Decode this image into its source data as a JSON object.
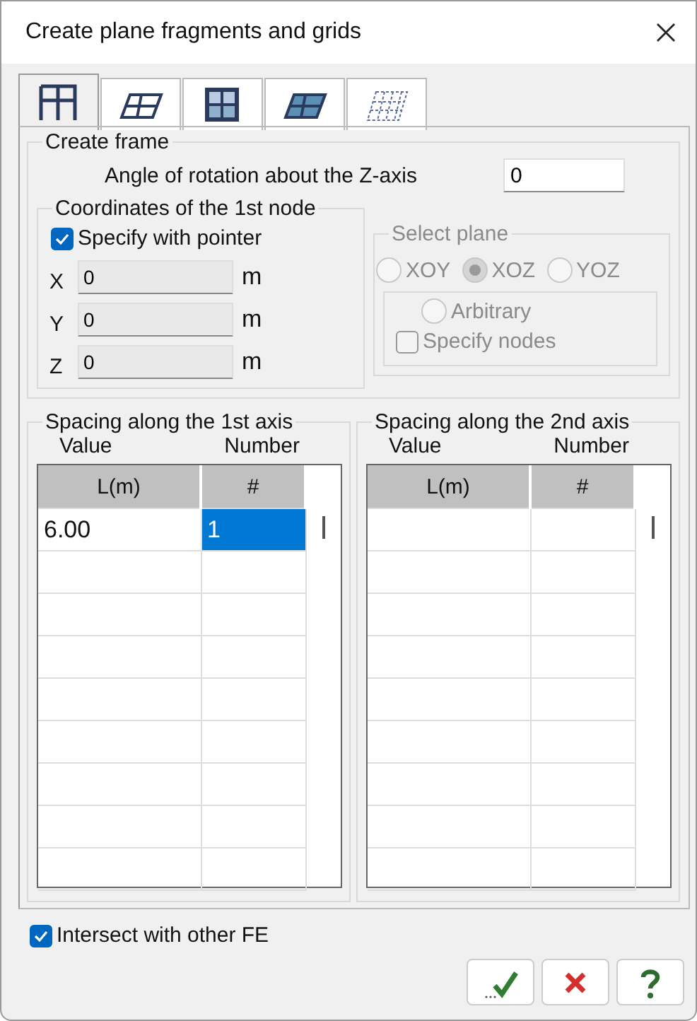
{
  "window": {
    "title": "Create plane fragments and grids"
  },
  "tabs": [
    {
      "kind": "frame",
      "selected": true
    },
    {
      "kind": "plane",
      "selected": false
    },
    {
      "kind": "plate",
      "selected": false
    },
    {
      "kind": "skew-plate",
      "selected": false
    },
    {
      "kind": "mesh",
      "selected": false
    }
  ],
  "create_frame": {
    "title": "Create frame",
    "angle_label": "Angle of rotation about the Z-axis",
    "angle_value": "0",
    "coordinates": {
      "title": "Coordinates of the 1st node",
      "pointer": {
        "label": "Specify with pointer",
        "checked": true
      },
      "fields": [
        {
          "axis": "X",
          "value": "0",
          "unit": "m"
        },
        {
          "axis": "Y",
          "value": "0",
          "unit": "m"
        },
        {
          "axis": "Z",
          "value": "0",
          "unit": "m"
        }
      ]
    },
    "select_plane": {
      "title": "Select plane",
      "disabled": true,
      "planes": [
        {
          "label": "XOY",
          "selected": false
        },
        {
          "label": "XOZ",
          "selected": true
        },
        {
          "label": "YOZ",
          "selected": false
        }
      ],
      "arbitrary": {
        "label": "Arbitrary",
        "selected": false
      },
      "specify_nodes": {
        "label": "Specify nodes",
        "checked": false
      }
    }
  },
  "spacing": [
    {
      "title": "Spacing along the 1st axis",
      "headings": [
        "Value",
        "Number"
      ],
      "columns": [
        "L(m)",
        "#"
      ],
      "rows": [
        [
          {
            "text": "6.00",
            "selected": false
          },
          {
            "text": "1",
            "selected": true
          }
        ]
      ]
    },
    {
      "title": "Spacing along the 2nd axis",
      "headings": [
        "Value",
        "Number"
      ],
      "columns": [
        "L(m)",
        "#"
      ]
    }
  ],
  "intersect": {
    "label": "Intersect with other FE",
    "checked": true
  },
  "buttons": [
    {
      "kind": "ok"
    },
    {
      "kind": "cancel"
    },
    {
      "kind": "help"
    }
  ]
}
